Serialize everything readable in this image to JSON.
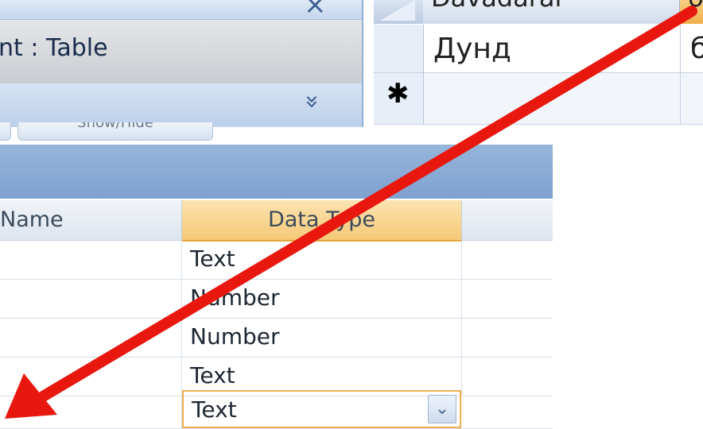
{
  "nav_pane": {
    "close_glyph": "×",
    "title": "nt : Table",
    "chevron_glyph": "»"
  },
  "datasheet": {
    "columns": [
      "Dаvаdаrаl",
      "б"
    ],
    "rows": [
      {
        "cells": [
          "Дунд",
          "б"
        ]
      }
    ],
    "new_row_marker": "✱"
  },
  "design_view": {
    "tabs": [
      {
        "label": ""
      },
      {
        "label": "Show/Hide"
      }
    ],
    "columns": {
      "field_name": "Name",
      "data_type": "Data Type",
      "description": ""
    },
    "rows": [
      {
        "field": "",
        "type": "Text"
      },
      {
        "field": "",
        "type": "Number"
      },
      {
        "field": "",
        "type": "Number"
      },
      {
        "field": "",
        "type": "Text"
      },
      {
        "field": "",
        "type": "Text"
      }
    ],
    "dropdown_glyph": "⌄"
  },
  "colors": {
    "arrow": "#e8180f",
    "header_accent": "#f0b04c",
    "ribbon_blue": "#8fb0d9"
  },
  "icons": [
    "close-icon",
    "chevron-down-double-icon",
    "new-record-icon",
    "dropdown-arrow-icon",
    "annotation-arrow"
  ]
}
